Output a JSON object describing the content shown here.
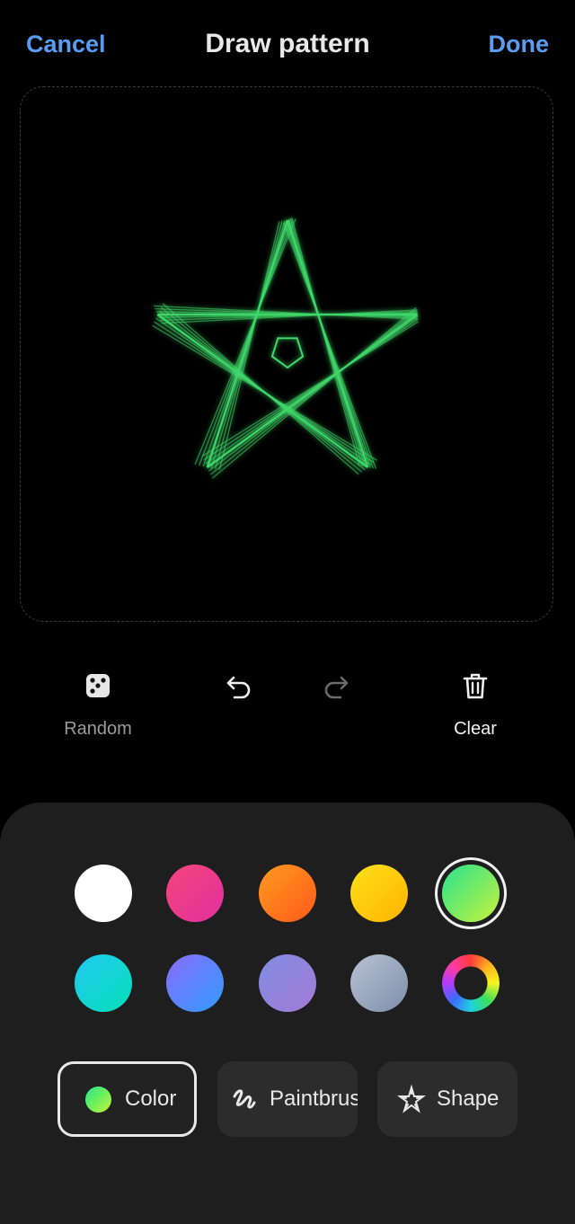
{
  "header": {
    "cancel_label": "Cancel",
    "title": "Draw pattern",
    "done_label": "Done"
  },
  "canvas": {
    "pattern_shape": "star",
    "pattern_color": "#3fd86a"
  },
  "toolbar": {
    "random_label": "Random",
    "random_icon": "dice-icon",
    "undo_icon": "undo-icon",
    "redo_icon": "redo-icon",
    "redo_enabled": false,
    "clear_label": "Clear",
    "clear_icon": "trash-icon"
  },
  "palette": {
    "selected_index": 4,
    "swatches": [
      {
        "name": "white",
        "colors": [
          "#ffffff",
          "#ffffff"
        ]
      },
      {
        "name": "pink",
        "colors": [
          "#f5457a",
          "#e0309e"
        ]
      },
      {
        "name": "orange",
        "colors": [
          "#ff9a1f",
          "#ff5a18"
        ]
      },
      {
        "name": "yellow",
        "colors": [
          "#ffe11a",
          "#ffb300"
        ]
      },
      {
        "name": "green",
        "colors": [
          "#27e38f",
          "#c8f23c"
        ]
      },
      {
        "name": "cyan",
        "colors": [
          "#22c8f0",
          "#06e0b8"
        ]
      },
      {
        "name": "blue-violet",
        "colors": [
          "#8a6cf8",
          "#2f9bff"
        ]
      },
      {
        "name": "lavender",
        "colors": [
          "#7f8ee0",
          "#a37ad8"
        ]
      },
      {
        "name": "grey-blue",
        "colors": [
          "#b8c2d4",
          "#7e8eaa"
        ]
      },
      {
        "name": "color-wheel",
        "colors": []
      }
    ]
  },
  "tabs": {
    "color_label": "Color",
    "paintbrush_label": "Paintbrush",
    "shape_label": "Shape",
    "active": "Color"
  }
}
